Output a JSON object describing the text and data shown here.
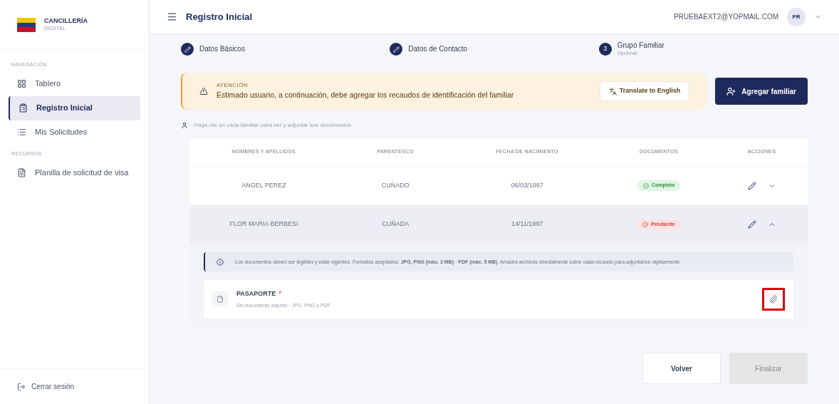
{
  "brand": {
    "name": "CANCILLERÍA",
    "subtitle": "DIGITAL"
  },
  "sidebar": {
    "sections": [
      {
        "title": "NAVEGACIÓN",
        "items": [
          {
            "label": "Tablero",
            "selected": false
          },
          {
            "label": "Registro Inicial",
            "selected": true
          },
          {
            "label": "Mis Solicitudes",
            "selected": false
          }
        ]
      },
      {
        "title": "RECURSOS",
        "items": [
          {
            "label": "Planilla de solicitud de visa",
            "selected": false
          }
        ]
      }
    ],
    "logout": "Cerrar sesión"
  },
  "header": {
    "title": "Registro Inicial",
    "user_email": "PRUEBAEXT2@YOPMAIL.COM",
    "avatar": "PR"
  },
  "steps": [
    {
      "label": "Datos Básicos",
      "kind": "done"
    },
    {
      "label": "Datos de Contacto",
      "kind": "done"
    },
    {
      "label": "Grupo Familiar",
      "number": "3",
      "sublabel": "Opcional",
      "kind": "numbered"
    }
  ],
  "alert": {
    "title": "ATENCIÓN",
    "message": "Estimado usuario, a continuación, debe agregar los recaudos de identificación del familiar",
    "translate_button": "Translate to English"
  },
  "add_button": "Agregar familiar",
  "hint": "Haga clic en cada familiar para ver y adjuntar sus documentos",
  "table": {
    "columns": [
      "NOMBRES Y APELLIDOS",
      "PARENTESCO",
      "FECHA DE NACIMIENTO",
      "DOCUMENTOS",
      "ACCIONES"
    ],
    "rows": [
      {
        "name": "ANGEL PEREZ",
        "relation": "CUÑADO",
        "birth_date": "06/03/1997",
        "documents": "Completo",
        "kind": "complete",
        "expanded": false
      },
      {
        "name": "FLOR MARIA BERBESI",
        "relation": "CUÑADA",
        "birth_date": "14/11/1997",
        "documents": "Pendiente",
        "kind": "pending",
        "expanded": true
      }
    ]
  },
  "detail": {
    "info": "Los documentos deben ser legibles y estar vigentes. Formatos aceptados: **JPG, PNG (máx. 3 MB)** · **PDF (máx. 5 MB)**. Arrastra archivos directamente sobre cada recaudo para adjuntarlos rápidamente.",
    "documents": [
      {
        "name": "PASAPORTE",
        "required_mark": "*",
        "status": "Sin documento adjunto · JPG, PNG y PDF",
        "highlighted": true
      }
    ]
  },
  "footer": {
    "back": "Volver",
    "finish": {
      "label": "Finalizar",
      "disabled": true
    }
  }
}
